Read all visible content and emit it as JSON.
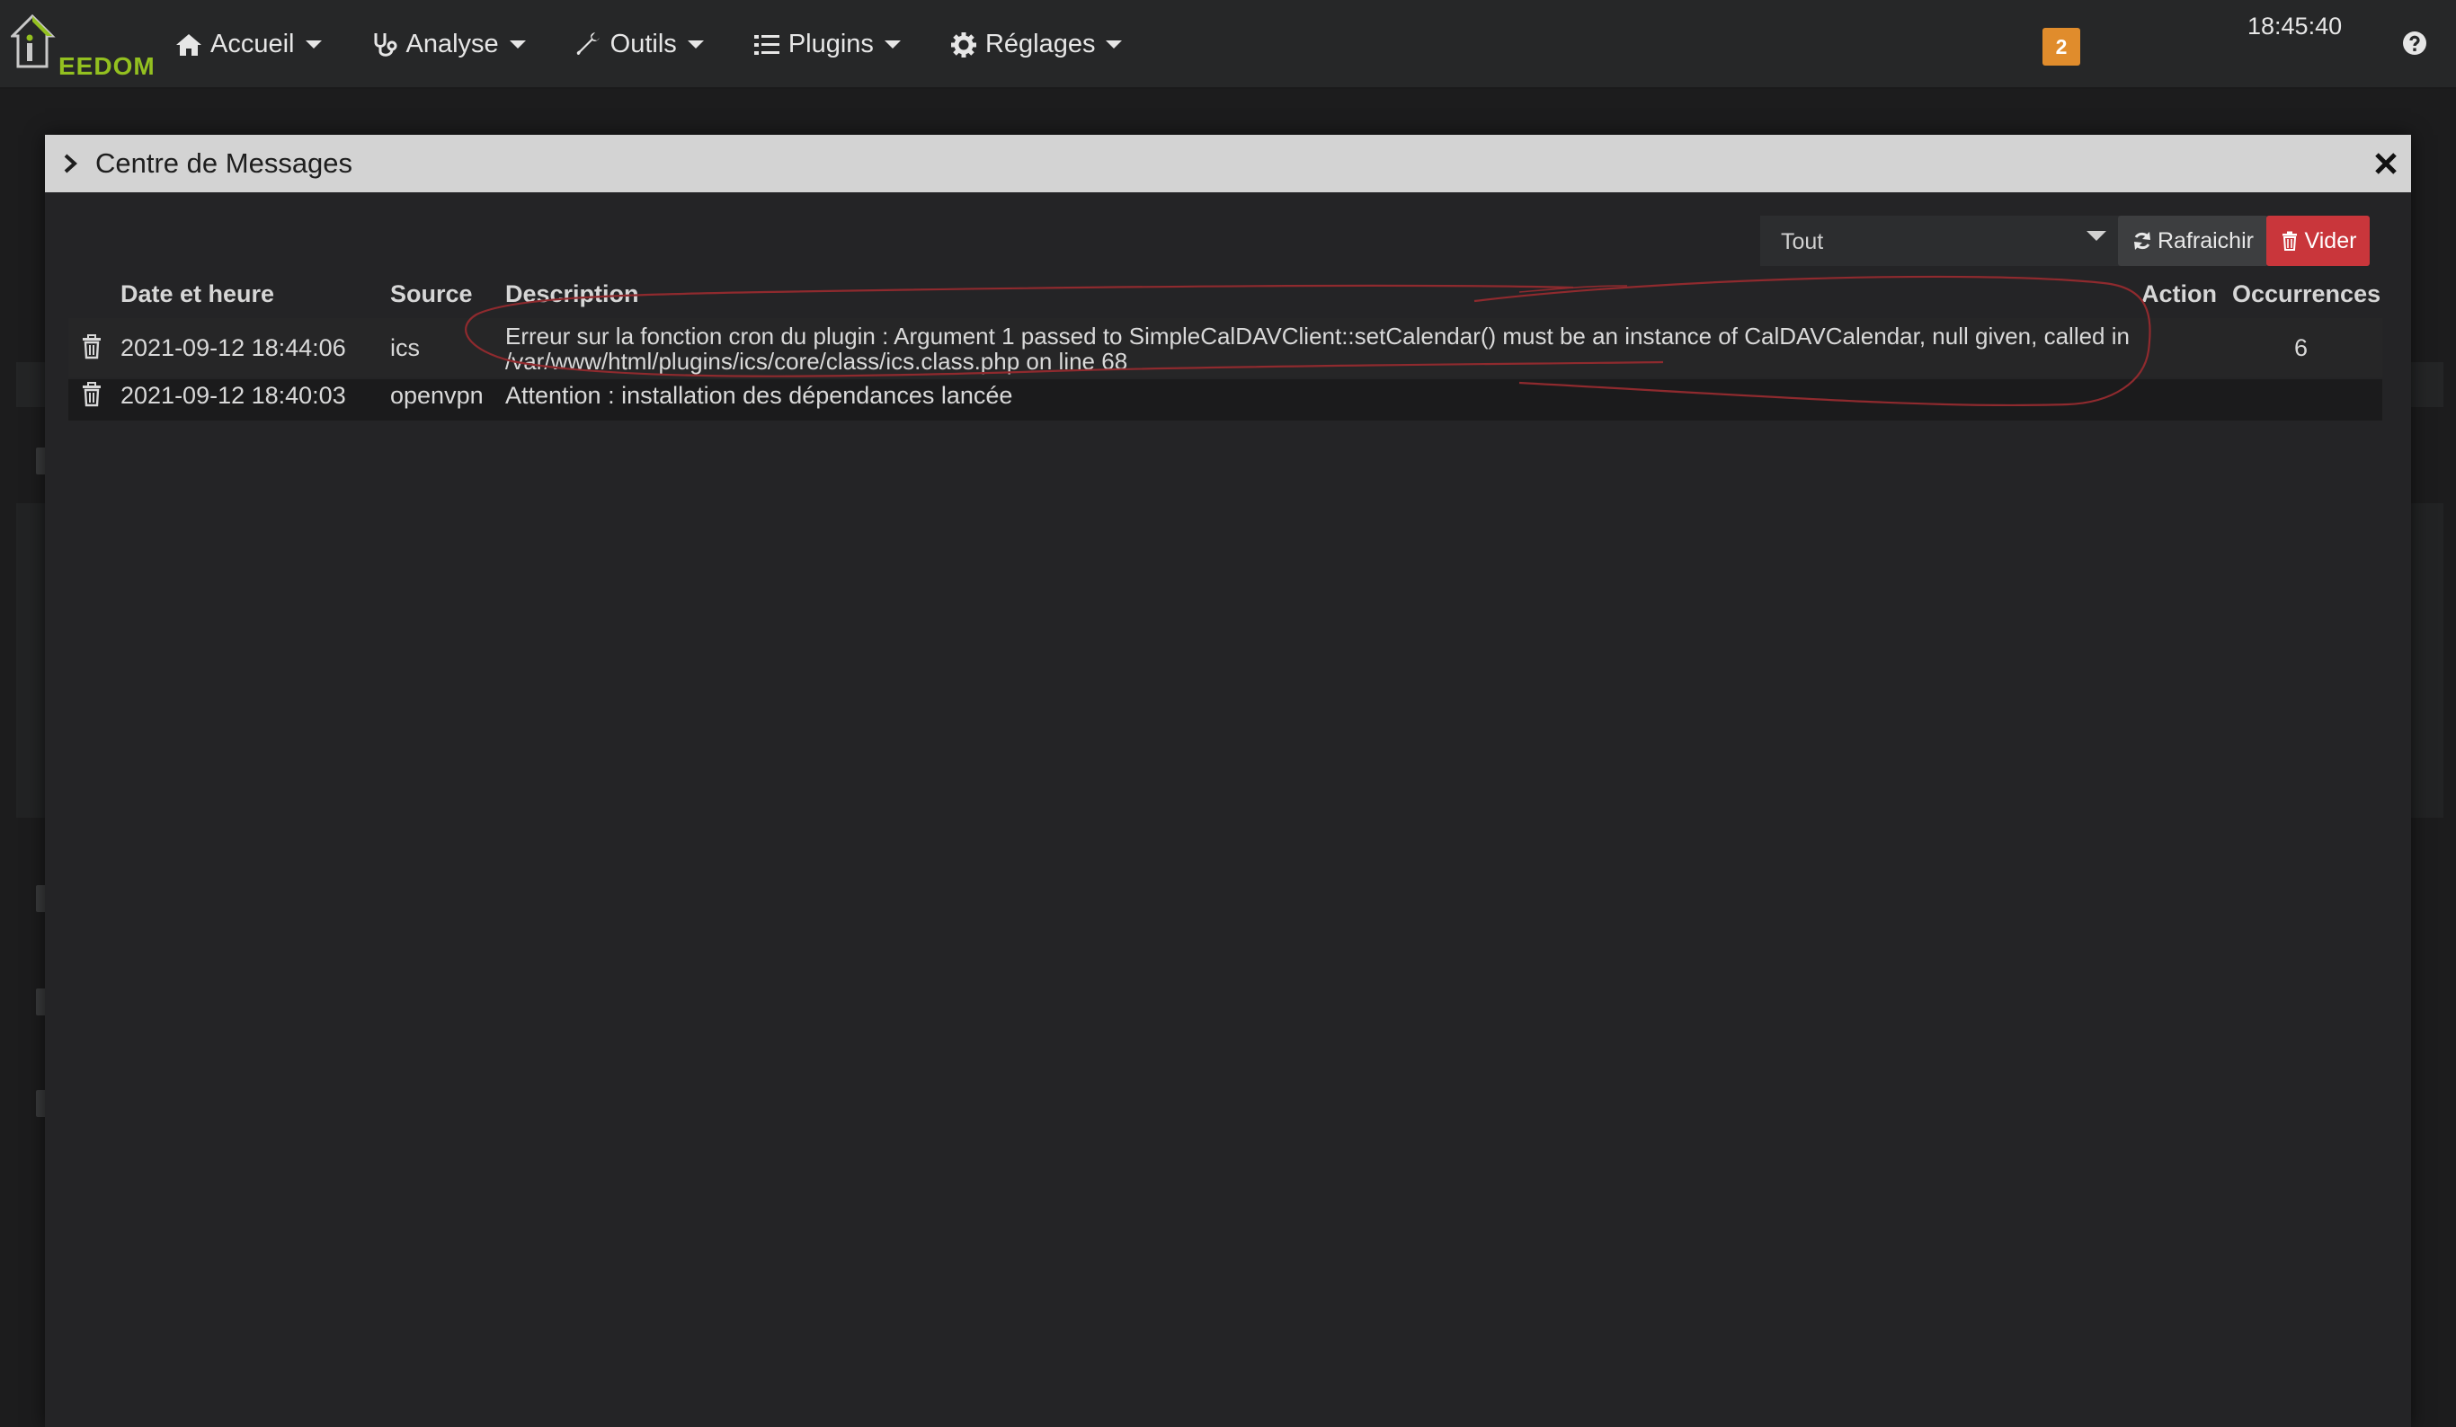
{
  "navbar": {
    "logo_text": "EEDOM",
    "menu": [
      {
        "label": "Accueil",
        "icon": "home-icon"
      },
      {
        "label": "Analyse",
        "icon": "stethoscope-icon"
      },
      {
        "label": "Outils",
        "icon": "wrench-icon"
      },
      {
        "label": "Plugins",
        "icon": "list-icon"
      },
      {
        "label": "Réglages",
        "icon": "gear-icon"
      }
    ],
    "notification_count": "2",
    "clock": "18:45:40",
    "help_icon": "question-circle-icon"
  },
  "modal": {
    "title": "Centre de Messages",
    "filter": {
      "selected": "Tout"
    },
    "buttons": {
      "refresh_label": "Rafraichir",
      "clear_label": "Vider"
    },
    "table": {
      "headers": {
        "date": "Date et heure",
        "source": "Source",
        "description": "Description",
        "action": "Action",
        "occurrences": "Occurrences"
      },
      "rows": [
        {
          "date": "2021-09-12 18:44:06",
          "source": "ics",
          "description": "Erreur sur la fonction cron du plugin : Argument 1 passed to SimpleCalDAVClient::setCalendar() must be an instance of CalDAVCalendar, null given, called in /var/www/html/plugins/ics/core/class/ics.class.php on line 68",
          "action": "",
          "occurrences": "6"
        },
        {
          "date": "2021-09-12 18:40:03",
          "source": "openvpn",
          "description": "Attention : installation des dépendances lancée",
          "action": "",
          "occurrences": ""
        }
      ]
    }
  },
  "colors": {
    "navbar_bg": "#262728",
    "logo_green": "#93c020",
    "badge_orange": "#e08c2c",
    "clear_red": "#c9363b",
    "annotation_red": "#8f2a2e"
  }
}
